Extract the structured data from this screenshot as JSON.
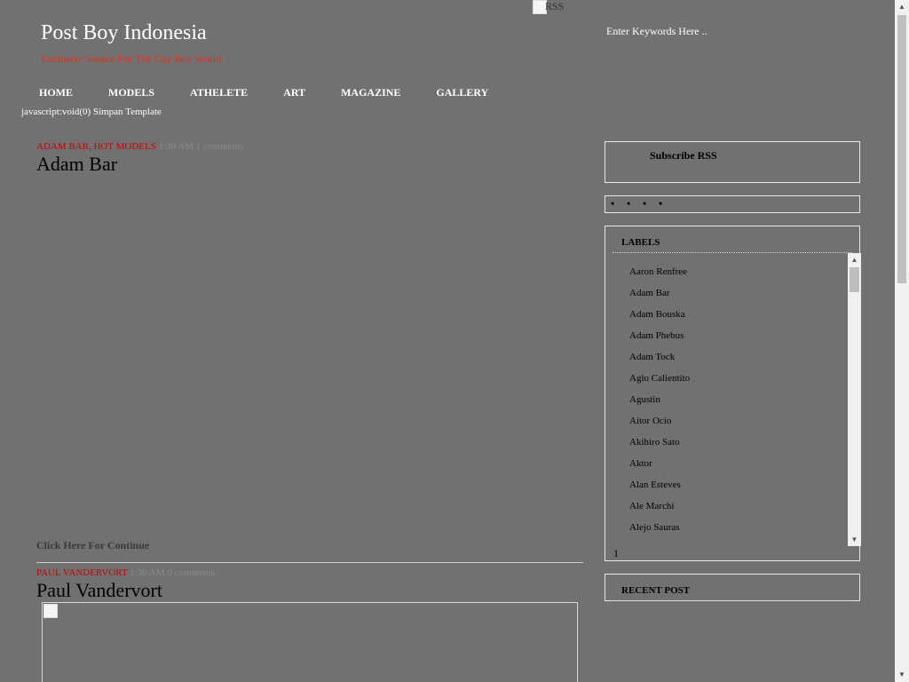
{
  "header": {
    "rss_alt": "RSS",
    "site_title": "Post Boy Indonesia",
    "site_description": "Exclusive Source For The Gay Boy World",
    "search_placeholder": "Enter Keywords Here .."
  },
  "nav": {
    "items": [
      {
        "label": "HOME"
      },
      {
        "label": "MODELS"
      },
      {
        "label": "ATHELETE"
      },
      {
        "label": "ART"
      },
      {
        "label": "MAGAZINE"
      },
      {
        "label": "GALLERY"
      }
    ],
    "sub_link": "javascript:void(0) Simpan Template"
  },
  "posts": [
    {
      "labels": "ADAM BAR, HOT MODELS",
      "meta": "   1:30 AM   1 comments",
      "title": "Adam Bar",
      "continue_label": "Click Here For Continue"
    },
    {
      "labels": "PAUL VANDERVORT",
      "meta": "   1:30 AM   0 comments",
      "title": "Paul Vandervort"
    }
  ],
  "sidebar": {
    "subscribe_title": "Subscribe RSS",
    "dots": [
      "•",
      "•",
      "•",
      "•"
    ],
    "labels_title": "LABELS",
    "labels": [
      "Aaron Renfree",
      "Adam Bar",
      "Adam Bouska",
      "Adam Phebus",
      "Adam Tock",
      "Aglo Calientito",
      "Agustin",
      "Aitor Ocio",
      "Akihiro Sato",
      "Aktor",
      "Alan Esteves",
      "Ale Marchi",
      "Alejo Sauras"
    ],
    "labels_count": "1",
    "recent_title": "RECENT POST"
  },
  "icons": {
    "scroll_up": "scroll-up-arrow-icon",
    "scroll_down": "scroll-down-arrow-icon"
  }
}
